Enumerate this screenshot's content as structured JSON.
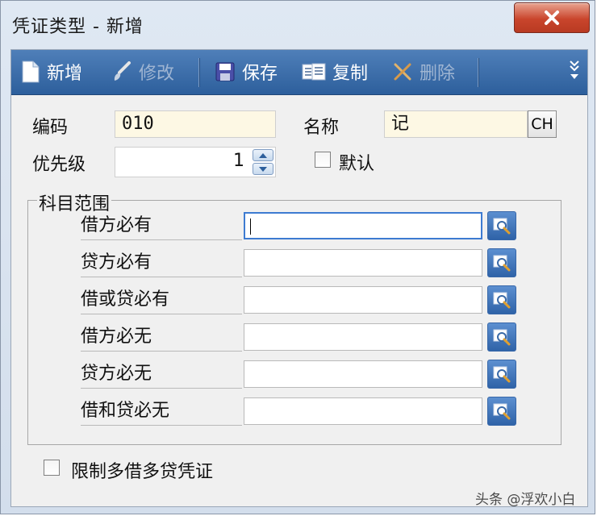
{
  "window": {
    "title": "凭证类型 - 新增"
  },
  "toolbar": {
    "new": "新增",
    "edit": "修改",
    "save": "保存",
    "copy": "复制",
    "delete": "删除"
  },
  "form": {
    "code_label": "编码",
    "code_value": "010",
    "name_label": "名称",
    "name_value": "记",
    "ch_button": "CH",
    "priority_label": "优先级",
    "priority_value": "1",
    "default_label": "默认",
    "default_checked": false
  },
  "subject_range": {
    "title": "科目范围",
    "rows": [
      {
        "label": "借方必有",
        "value": ""
      },
      {
        "label": "贷方必有",
        "value": ""
      },
      {
        "label": "借或贷必有",
        "value": ""
      },
      {
        "label": "借方必无",
        "value": ""
      },
      {
        "label": "贷方必无",
        "value": ""
      },
      {
        "label": "借和贷必无",
        "value": ""
      }
    ]
  },
  "limit": {
    "label": "限制多借多贷凭证",
    "checked": false
  },
  "watermark": "头条 @浮欢小白",
  "colors": {
    "toolbar": "#3a6aa8",
    "required_field": "#fdf8e4",
    "close_button": "#c9452c"
  }
}
